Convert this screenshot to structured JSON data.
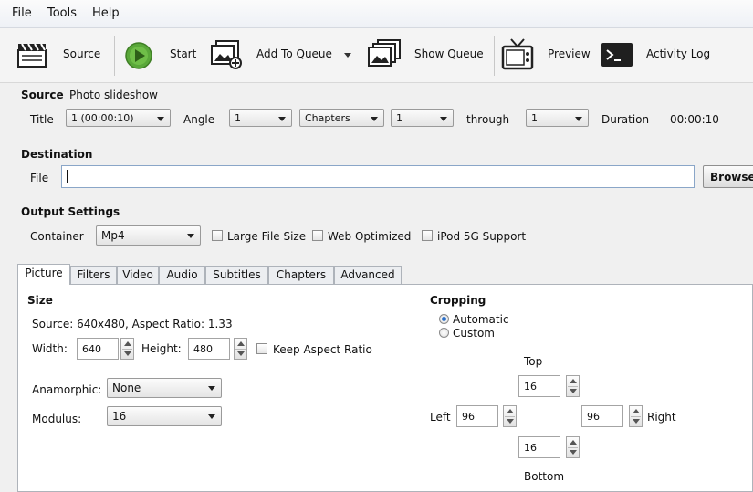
{
  "menu": {
    "file": "File",
    "tools": "Tools",
    "help": "Help"
  },
  "toolbar": {
    "source": "Source",
    "start": "Start",
    "add_to_queue": "Add To Queue",
    "show_queue": "Show Queue",
    "preview": "Preview",
    "activity_log": "Activity Log"
  },
  "source": {
    "label": "Source",
    "name": "Photo slideshow",
    "title_label": "Title",
    "title_value": "1 (00:00:10)",
    "angle_label": "Angle",
    "angle_value": "1",
    "range_mode": "Chapters",
    "range_start": "1",
    "through_label": "through",
    "range_end": "1",
    "duration_label": "Duration",
    "duration_value": "00:00:10"
  },
  "destination": {
    "heading": "Destination",
    "file_label": "File",
    "file_value": "",
    "browse_label": "Browse"
  },
  "output": {
    "heading": "Output Settings",
    "container_label": "Container",
    "container_value": "Mp4",
    "large_file": "Large File Size",
    "web_optimized": "Web Optimized",
    "ipod": "iPod 5G Support"
  },
  "tabs": [
    "Picture",
    "Filters",
    "Video",
    "Audio",
    "Subtitles",
    "Chapters",
    "Advanced"
  ],
  "picture": {
    "size_heading": "Size",
    "source_info": "Source:  640x480, Aspect Ratio: 1.33",
    "width_label": "Width:",
    "width_value": "640",
    "height_label": "Height:",
    "height_value": "480",
    "keep_aspect": "Keep Aspect Ratio",
    "anamorphic_label": "Anamorphic:",
    "anamorphic_value": "None",
    "modulus_label": "Modulus:",
    "modulus_value": "16",
    "cropping_heading": "Cropping",
    "automatic": "Automatic",
    "custom": "Custom",
    "top_label": "Top",
    "top_value": "16",
    "left_label": "Left",
    "left_value": "96",
    "right_value": "96",
    "right_label": "Right",
    "bottom_value": "16",
    "bottom_label": "Bottom"
  }
}
